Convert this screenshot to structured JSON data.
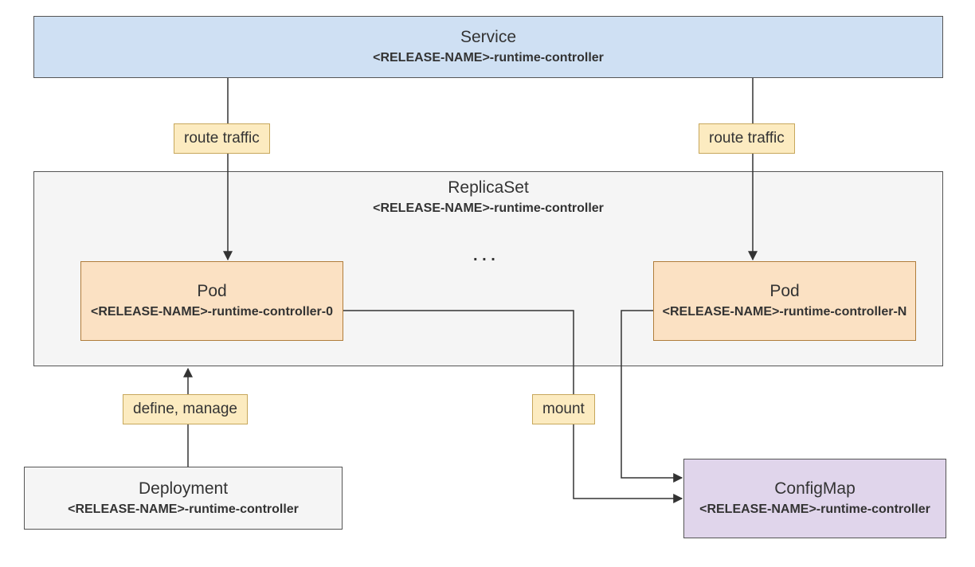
{
  "service": {
    "title": "Service",
    "subtitle": "<RELEASE-NAME>-runtime-controller"
  },
  "replicaset": {
    "title": "ReplicaSet",
    "subtitle": "<RELEASE-NAME>-runtime-controller"
  },
  "pod0": {
    "title": "Pod",
    "subtitle": "<RELEASE-NAME>-runtime-controller-0"
  },
  "podN": {
    "title": "Pod",
    "subtitle": "<RELEASE-NAME>-runtime-controller-N"
  },
  "ellipsis": ". . .",
  "deployment": {
    "title": "Deployment",
    "subtitle": "<RELEASE-NAME>-runtime-controller"
  },
  "configmap": {
    "title": "ConfigMap",
    "subtitle": "<RELEASE-NAME>-runtime-controller"
  },
  "labels": {
    "route_traffic_left": "route traffic",
    "route_traffic_right": "route traffic",
    "define_manage": "define, manage",
    "mount": "mount"
  },
  "edges": [
    {
      "from": "service",
      "to": "pod0",
      "label": "route traffic"
    },
    {
      "from": "service",
      "to": "podN",
      "label": "route traffic"
    },
    {
      "from": "deployment",
      "to": "replicaset",
      "label": "define, manage"
    },
    {
      "from": "pod0",
      "to": "configmap",
      "label": "mount"
    },
    {
      "from": "podN",
      "to": "configmap",
      "label": "mount"
    }
  ]
}
